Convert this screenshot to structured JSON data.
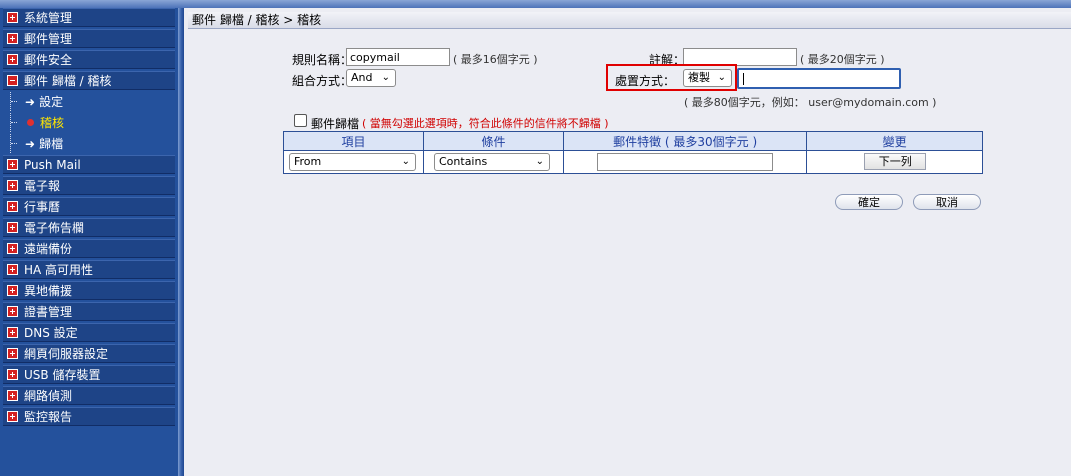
{
  "sidebar": {
    "items": [
      {
        "label": "系統管理",
        "type": "plus"
      },
      {
        "label": "郵件管理",
        "type": "plus"
      },
      {
        "label": "郵件安全",
        "type": "plus"
      },
      {
        "label": "郵件 歸檔 / 稽核",
        "type": "minus"
      },
      {
        "label": "設定",
        "type": "sub"
      },
      {
        "label": "稽核",
        "type": "sub-active"
      },
      {
        "label": "歸檔",
        "type": "sub"
      },
      {
        "label": "Push Mail",
        "type": "plus"
      },
      {
        "label": "電子報",
        "type": "plus"
      },
      {
        "label": "行事曆",
        "type": "plus"
      },
      {
        "label": "電子佈告欄",
        "type": "plus"
      },
      {
        "label": "遠端備份",
        "type": "plus"
      },
      {
        "label": "HA 高可用性",
        "type": "plus"
      },
      {
        "label": "異地備援",
        "type": "plus"
      },
      {
        "label": "證書管理",
        "type": "plus"
      },
      {
        "label": "DNS 設定",
        "type": "plus"
      },
      {
        "label": "網頁伺服器設定",
        "type": "plus"
      },
      {
        "label": "USB 儲存裝置",
        "type": "plus"
      },
      {
        "label": "網路偵測",
        "type": "plus"
      },
      {
        "label": "監控報告",
        "type": "plus"
      }
    ]
  },
  "breadcrumb": "郵件 歸檔 / 稽核 > 稽核",
  "form": {
    "rule_name_label": "規則名稱：",
    "rule_name_value": "copymail",
    "rule_name_hint": "( 最多16個字元 )",
    "combine_label": "組合方式：",
    "combine_value": "And",
    "comment_label": "註解：",
    "comment_value": "",
    "comment_hint": "( 最多20個字元 )",
    "action_label": "處置方式：",
    "action_value": "複製",
    "action_target_value": "",
    "action_hint": "( 最多80個字元，例如： user@mydomain.com )",
    "archive_label": "郵件歸檔",
    "archive_note": "( 當無勾選此選項時，符合此條件的信件將不歸檔 )"
  },
  "table": {
    "headers": [
      "項目",
      "條件",
      "郵件特徵 ( 最多30個字元 )",
      "變更"
    ],
    "row": {
      "item": "From",
      "condition": "Contains",
      "feature": "",
      "change_button": "下一列"
    }
  },
  "buttons": {
    "ok": "確定",
    "cancel": "取消"
  }
}
